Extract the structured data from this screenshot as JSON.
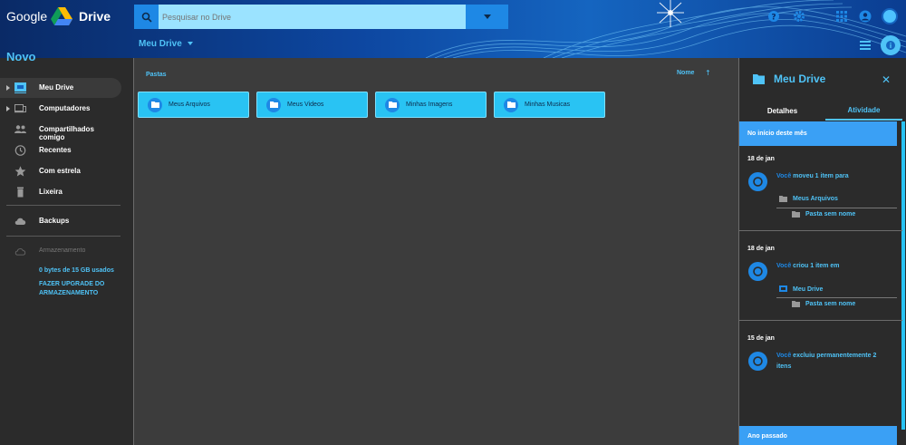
{
  "header": {
    "google_logo": "Google",
    "app_name": "Drive",
    "search": {
      "placeholder": "Pesquisar no Drive",
      "value": ""
    },
    "icons": [
      "help-icon",
      "settings-icon",
      "apps-grid-icon",
      "account-icon"
    ]
  },
  "subbar": {
    "location_title": "Meu Drive"
  },
  "new_button": "Novo",
  "sidebar": {
    "items": [
      {
        "label": "Meu Drive",
        "icon": "my-drive-icon",
        "active": true
      },
      {
        "label": "Computadores",
        "icon": "computers-icon",
        "active": false
      },
      {
        "label": "Compartilhados comigo",
        "icon": "shared-icon",
        "active": false
      },
      {
        "label": "Recentes",
        "icon": "clock-icon",
        "active": false
      },
      {
        "label": "Com estrela",
        "icon": "star-icon",
        "active": false
      },
      {
        "label": "Lixeira",
        "icon": "trash-icon",
        "active": false
      }
    ],
    "backups": "Backups",
    "storage_label": "Armazenamento",
    "storage_used": "0 bytes de 15 GB usados",
    "upgrade": "FAZER UPGRADE DO ARMAZENAMENTO"
  },
  "main": {
    "section_title": "Pastas",
    "sort_label": "Nome",
    "sort_arrow": "↑",
    "folders": [
      {
        "name": "Meus Arquivos"
      },
      {
        "name": "Meus Videos"
      },
      {
        "name": "Minhas Imagens"
      },
      {
        "name": "Minhas Musicas"
      }
    ]
  },
  "panel": {
    "title": "Meu Drive",
    "tabs": {
      "details": "Detalhes",
      "activity": "Atividade"
    },
    "period_current": "No início deste mês",
    "period_previous": "Ano passado",
    "entries": [
      {
        "date": "18 de jan",
        "actor": "Você",
        "action": "moveu 1 item para",
        "target": "Meus Arquivos",
        "item": "Pasta sem nome"
      },
      {
        "date": "18 de jan",
        "actor": "Você",
        "action": "criou 1 item em",
        "target": "Meu Drive",
        "item": "Pasta sem nome"
      },
      {
        "date": "15 de jan",
        "actor": "Você",
        "action": "excluiu permanentemente 2 itens"
      }
    ]
  },
  "colors": {
    "accent": "#4fc3f7",
    "accent_dark": "#1e88e5",
    "folder_fill": "#29c3f3",
    "background": "#2b2b2b",
    "main_background": "#3c3c3c"
  }
}
